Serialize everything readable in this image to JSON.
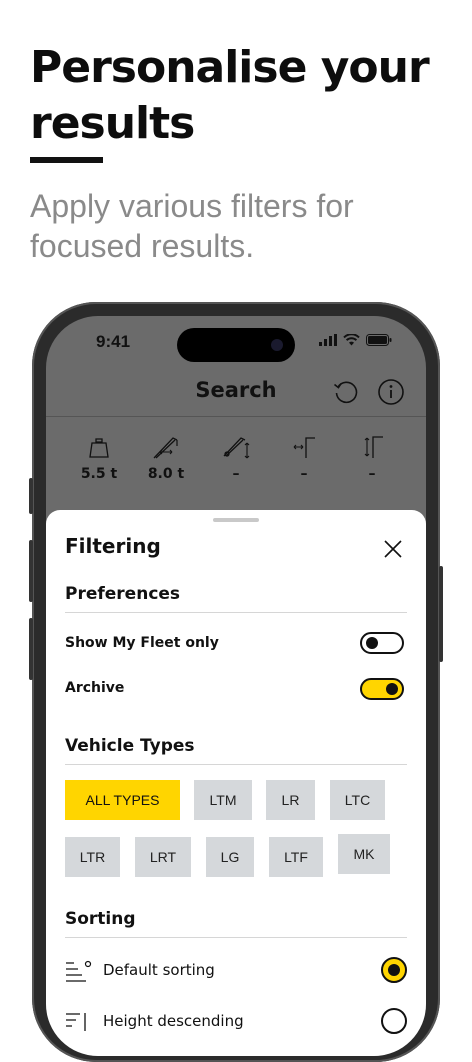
{
  "promo": {
    "headline": "Personalise your results",
    "subline": "Apply various filters for focused results."
  },
  "status_bar": {
    "time": "9:41"
  },
  "nav": {
    "title": "Search",
    "icons": [
      "reset-icon",
      "info-icon"
    ]
  },
  "stats": [
    {
      "icon": "weight-icon",
      "value": "5.5 t"
    },
    {
      "icon": "boom-load-icon",
      "value": "8.0 t"
    },
    {
      "icon": "boom-height-icon",
      "value": "–"
    },
    {
      "icon": "radius-icon",
      "value": "–"
    },
    {
      "icon": "height-icon",
      "value": "–"
    }
  ],
  "sheet": {
    "title": "Filtering",
    "preferences": {
      "title": "Preferences",
      "items": [
        {
          "label": "Show My Fleet only",
          "on": false
        },
        {
          "label": "Archive",
          "on": true
        }
      ]
    },
    "vehicle_types": {
      "title": "Vehicle Types",
      "chips": [
        "ALL TYPES",
        "LTM",
        "LR",
        "LTC",
        "LTR",
        "LRT",
        "LG",
        "LTF",
        "MK"
      ],
      "selected": "ALL TYPES"
    },
    "sorting": {
      "title": "Sorting",
      "options": [
        {
          "label": "Default sorting",
          "selected": true
        },
        {
          "label": "Height descending",
          "selected": false
        }
      ]
    }
  },
  "colors": {
    "accent": "#ffd500",
    "chip": "#d5d8db",
    "header_bg": "#6b6b6b"
  }
}
